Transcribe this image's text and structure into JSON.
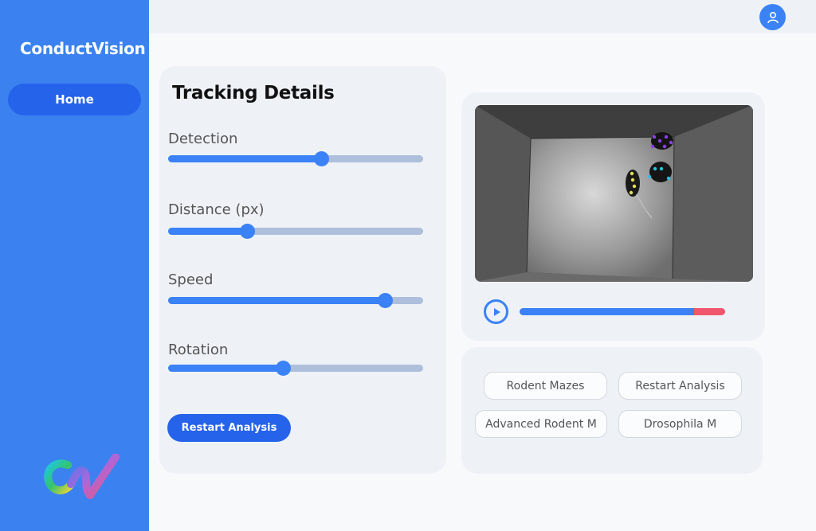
{
  "app": {
    "brand": "ConductVision"
  },
  "sidebar": {
    "items": [
      {
        "label": "Home"
      }
    ]
  },
  "header": {
    "avatar_icon": "user-icon"
  },
  "panel": {
    "title": "Tracking Details",
    "sliders": [
      {
        "label": "Detection",
        "value": 0.6
      },
      {
        "label": "Distance (px)",
        "value": 0.31
      },
      {
        "label": "Speed",
        "value": 0.85
      },
      {
        "label": "Rotation",
        "value": 0.45
      }
    ],
    "restart_label": "Restart Analysis"
  },
  "player": {
    "progress": 0.85,
    "play_icon": "play-icon"
  },
  "buttons": [
    {
      "label": "Rodent Mazes"
    },
    {
      "label": "Restart Analysis"
    },
    {
      "label": "Advanced Rodent M"
    },
    {
      "label": "Drosophila M"
    }
  ],
  "colors": {
    "primary": "#3b82f6",
    "primary_dark": "#2563eb",
    "progress_remaining": "#f0566c"
  }
}
